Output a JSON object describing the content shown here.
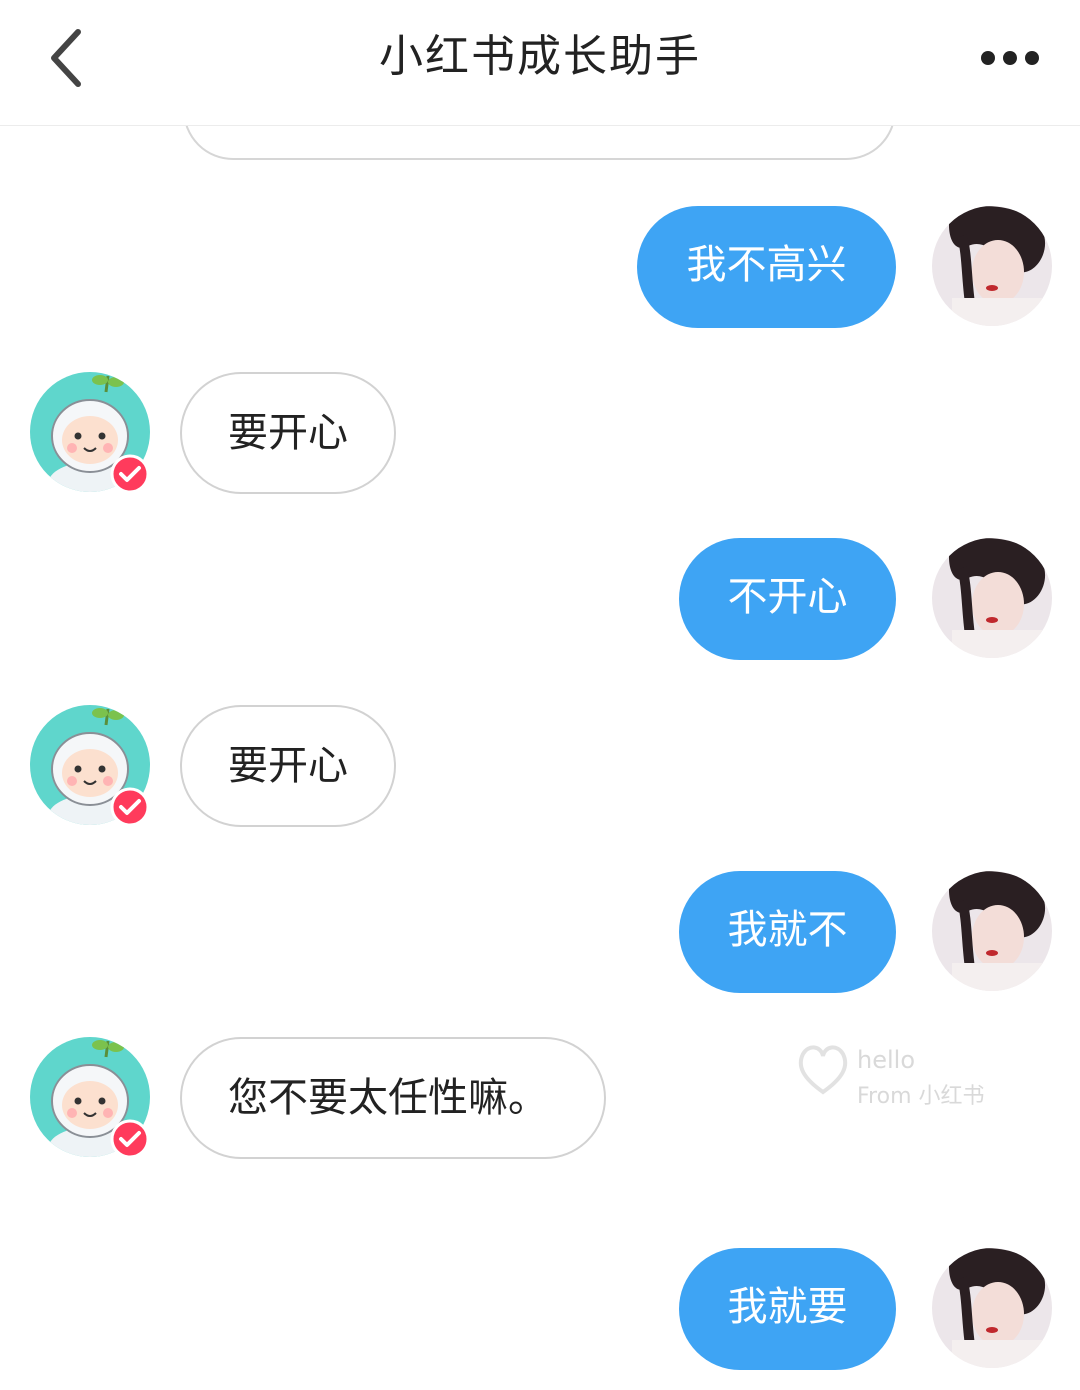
{
  "header": {
    "title": "小红书成长助手"
  },
  "messages": [
    {
      "side": "out",
      "text": "我不高兴"
    },
    {
      "side": "in",
      "text": "要开心"
    },
    {
      "side": "out",
      "text": "不开心"
    },
    {
      "side": "in",
      "text": "要开心"
    },
    {
      "side": "out",
      "text": "我就不"
    },
    {
      "side": "in",
      "text": "您不要太任性嘛。"
    },
    {
      "side": "out",
      "text": "我就要"
    }
  ],
  "watermark": {
    "line1": "hello",
    "line2": "From 小红书"
  },
  "colors": {
    "outgoing_bubble": "#3ea4f4",
    "incoming_border": "#d2d2d2",
    "assistant_avatar_bg": "#5fd6cc",
    "verified_badge": "#ff3b5c"
  },
  "icons": {
    "back": "chevron-left-icon",
    "more": "more-dots-icon",
    "verified": "check-badge-icon"
  }
}
